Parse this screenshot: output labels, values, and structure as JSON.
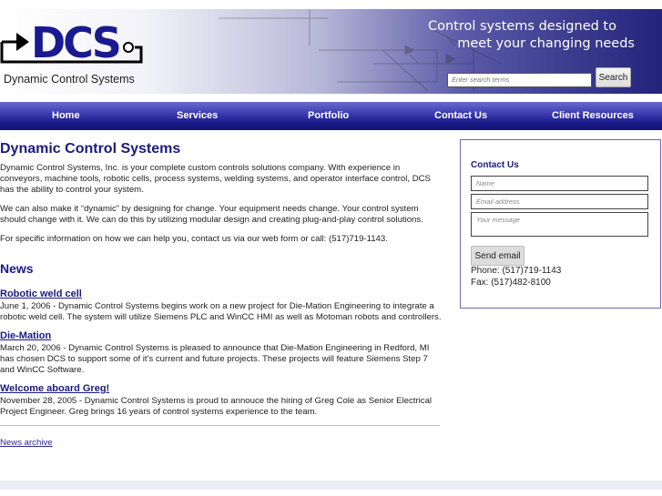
{
  "header": {
    "logo_text": "DCS",
    "company_name": "Dynamic Control Systems",
    "tagline": [
      "Control systems designed to",
      "meet your changing needs"
    ],
    "search": {
      "placeholder": "Enter search terms",
      "button": "Search"
    }
  },
  "nav": [
    "Home",
    "Services",
    "Portfolio",
    "Contact Us",
    "Client Resources"
  ],
  "main": {
    "title": "Dynamic Control Systems",
    "paragraphs": [
      "Dynamic Control Systems, Inc. is your complete custom controls solutions company. With experience in conveyors, machine tools, robotic cells, process systems, welding systems, and operator interface control, DCS has the ability to control your system.",
      "We can also make it “dynamic” by designing for change. Your equipment needs change. Your control system should change with it. We can do this by utilizing modular design and creating plug-and-play control solutions.",
      "For specific information on how we can help you, contact us via our web form or call: (517)719-1143."
    ],
    "news_heading": "News",
    "news": [
      {
        "title": "Robotic weld cell",
        "body": "June 1, 2006 - Dynamic Control Systems begins work on a new project for Die-Mation Engineering to integrate a robotic weld cell. The system will utilize Siemens PLC and WinCC HMI as well as Motoman robots and controllers."
      },
      {
        "title": "Die-Mation",
        "body": "March 20, 2006 - Dynamic Control Systems is pleased to announce that Die-Mation Engineering in Redford, MI has chosen DCS to support some of it's current and future projects. These projects will feature Siemens Step 7 and WinCC Software."
      },
      {
        "title": "Welcome aboard Greg!",
        "body": "November 28, 2005 - Dynamic Control Systems is proud to annouce the hiring of Greg Cole as Senior Electrical Project Engineer. Greg brings 16 years of control systems experience to the team."
      }
    ],
    "archive_link": "News archive"
  },
  "contact": {
    "heading": "Contact Us",
    "name_placeholder": "Name",
    "email_placeholder": "Email address",
    "message_placeholder": "Your message",
    "send_button": "Send email",
    "phone": "Phone: (517)719-1143",
    "fax": "Fax: (517)482-8100"
  },
  "colors": {
    "brand": "#1a1a80",
    "nav": "#2a2a9a"
  }
}
